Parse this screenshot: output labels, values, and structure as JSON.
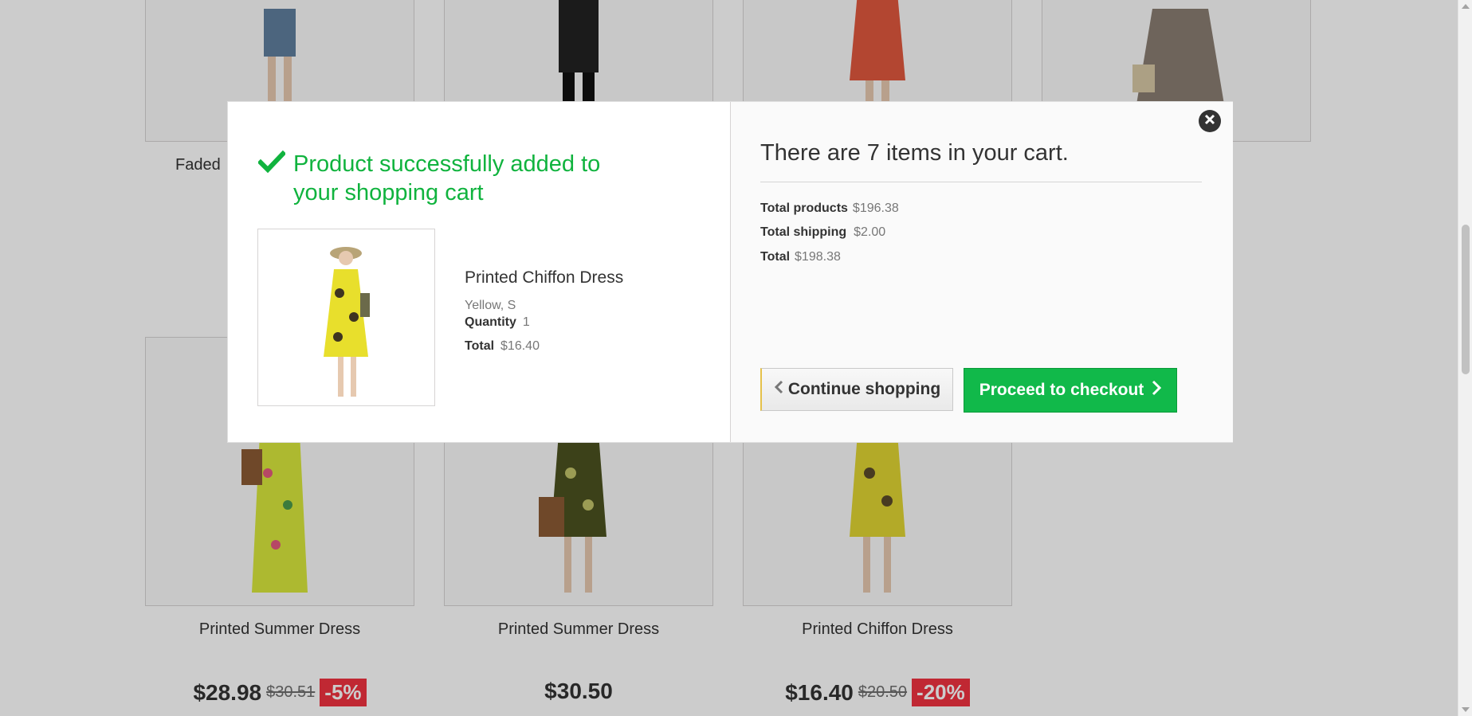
{
  "products_top": [
    {
      "name": "Faded"
    },
    {
      "name": ""
    },
    {
      "name": ""
    },
    {
      "name": ""
    }
  ],
  "products_bottom": [
    {
      "name": "Printed Summer Dress",
      "price": "$28.98",
      "old_price": "$30.51",
      "discount": "-5%"
    },
    {
      "name": "Printed Summer Dress",
      "price": "$30.50",
      "old_price": "",
      "discount": ""
    },
    {
      "name": "Printed Chiffon Dress",
      "price": "$16.40",
      "old_price": "$20.50",
      "discount": "-20%"
    }
  ],
  "modal": {
    "success_message": "Product successfully added to your shopping cart",
    "product": {
      "name": "Printed Chiffon Dress",
      "attributes": "Yellow, S",
      "quantity_label": "Quantity",
      "quantity": "1",
      "total_label": "Total",
      "total": "$16.40"
    },
    "cart": {
      "title": "There are 7 items in your cart.",
      "total_products_label": "Total products",
      "total_products": "$196.38",
      "total_shipping_label": "Total shipping",
      "total_shipping": "$2.00",
      "total_label": "Total",
      "total": "$198.38"
    },
    "continue_label": "Continue shopping",
    "checkout_label": "Proceed to checkout"
  },
  "colors": {
    "success": "#10b33e",
    "checkout_button": "#11b94a",
    "discount_badge": "#f13340"
  },
  "icons": {
    "success": "check-icon",
    "close": "close-icon",
    "continue": "chevron-left-icon",
    "checkout": "chevron-right-icon"
  }
}
